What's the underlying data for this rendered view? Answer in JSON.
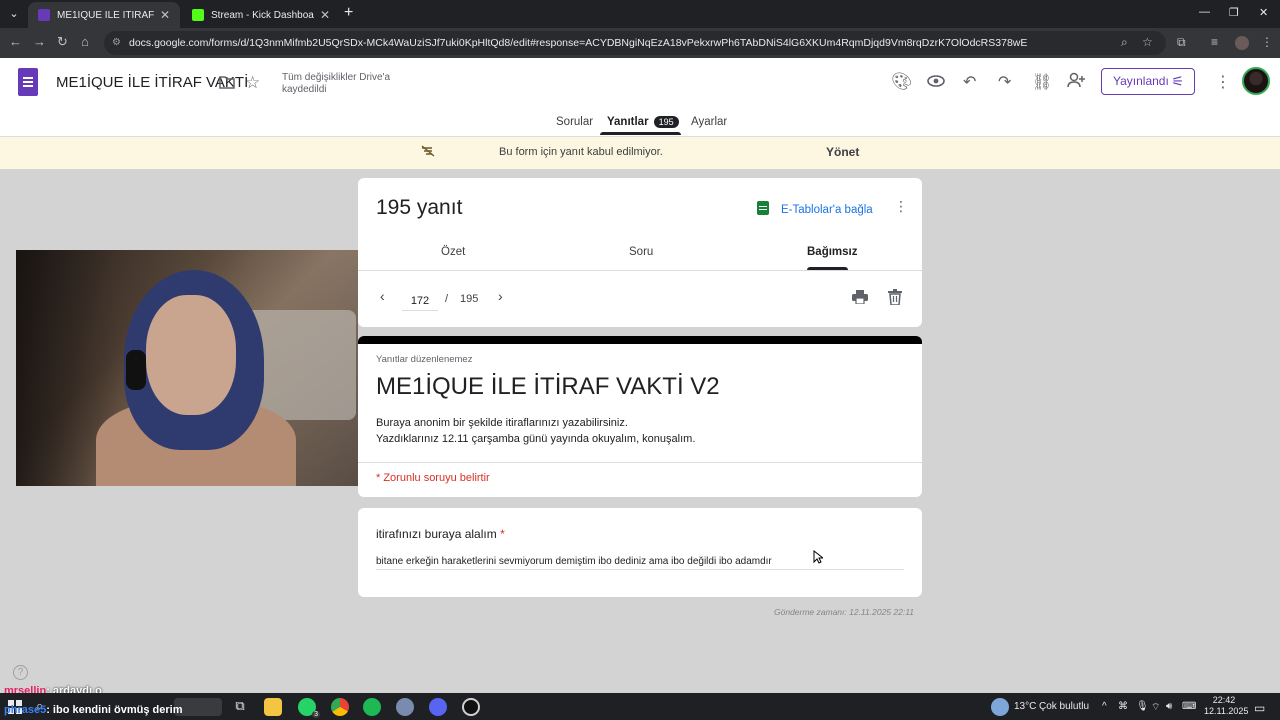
{
  "browser": {
    "tabs": [
      {
        "title": "ME1İQUE İLE İTİRAF VAKTİ - Go",
        "active": true,
        "favicon_color": "#673ab7"
      },
      {
        "title": "Stream - Kick Dashboard",
        "active": false,
        "favicon_color": "#53fc18"
      }
    ],
    "url": "docs.google.com/forms/d/1Q3nmMifmb2U5QrSDx-MCk4WaUziSJf7uki0KpHltQd8/edit#response=ACYDBNgiNqEzA18vPekxrwPh6TAbDNiS4lG6XKUm4RqmDjqd9Vm8rqDzrK7OlOdcRS378wE"
  },
  "forms_header": {
    "doc_title": "ME1İQUE İLE İTİRAF VAKTİ",
    "saved_status": "Tüm değişiklikler Drive'a kaydedildi",
    "publish_label": "Yayınlandı",
    "tabs": [
      {
        "label": "Sorular"
      },
      {
        "label": "Yanıtlar",
        "badge": "195"
      },
      {
        "label": "Ayarlar"
      }
    ]
  },
  "banner": {
    "message": "Bu form için yanıt kabul edilmiyor.",
    "action": "Yönet"
  },
  "summary": {
    "response_count": "195 yanıt",
    "sheets_link": "E-Tablolar'a bağla",
    "subtabs": [
      {
        "label": "Özet"
      },
      {
        "label": "Soru"
      },
      {
        "label": "Bağımsız"
      }
    ],
    "pager": {
      "current": "172",
      "separator": "/",
      "total": "195"
    }
  },
  "form": {
    "not_editable": "Yanıtlar düzenlenemez",
    "title": "ME1İQUE İLE İTİRAF VAKTİ V2",
    "description_line1": "Buraya anonim bir şekilde itiraflarınızı yazabilirsiniz.",
    "description_line2": "Yazdıklarınız 12.11 çarşamba günü yayında okuyalım, konuşalım.",
    "required_note": "* Zorunlu soruyu belirtir"
  },
  "question": {
    "title": "itirafınızı buraya alalım",
    "required_mark": "*",
    "answer": "bitane erkeğin haraketlerini sevmiyorum demiştim ibo dediniz ama ibo değildi ibo adamdır"
  },
  "sent_time": "Gönderme zamanı: 12.11.2025 22:11",
  "chat_overlay": {
    "line1_user": "mrsellin",
    "line1_text": ": ardaydı o",
    "line2_user": "phrase5",
    "line2_text": ": ibo kendini övmüş derim"
  },
  "taskbar": {
    "weather": "13°C",
    "weather_desc": "Çok bulutlu",
    "time": "22:42",
    "date": "12.11.2025",
    "badge_whatsapp": "3"
  },
  "colors": {
    "forms_purple": "#673ab7",
    "banner_bg": "#fdf6e0",
    "required_red": "#d93025",
    "link_blue": "#1a73e8"
  }
}
